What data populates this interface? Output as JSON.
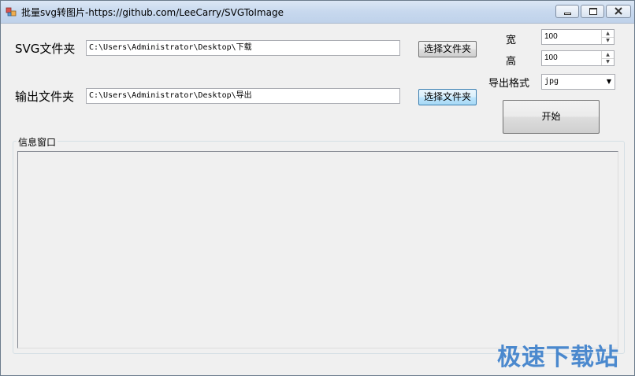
{
  "window": {
    "title": "批量svg转图片-https://github.com/LeeCarry/SVGToImage",
    "buttons": {
      "min": "minimize",
      "max": "maximize",
      "close": "close"
    }
  },
  "form": {
    "svg_folder_label": "SVG文件夹",
    "svg_folder_value": "C:\\Users\\Administrator\\Desktop\\下载",
    "svg_choose_label": "选择文件夹",
    "out_folder_label": "输出文件夹",
    "out_folder_value": "C:\\Users\\Administrator\\Desktop\\导出",
    "out_choose_label": "选择文件夹",
    "width_label": "宽",
    "width_value": "100",
    "height_label": "高",
    "height_value": "100",
    "format_label": "导出格式",
    "format_value": "jpg",
    "start_label": "开始"
  },
  "log": {
    "group_title": "信息窗口"
  },
  "watermark": "极速下载站",
  "icons": {
    "app": "app-icon",
    "spin_up": "▲",
    "spin_down": "▼",
    "combo_arrow": "▼"
  }
}
